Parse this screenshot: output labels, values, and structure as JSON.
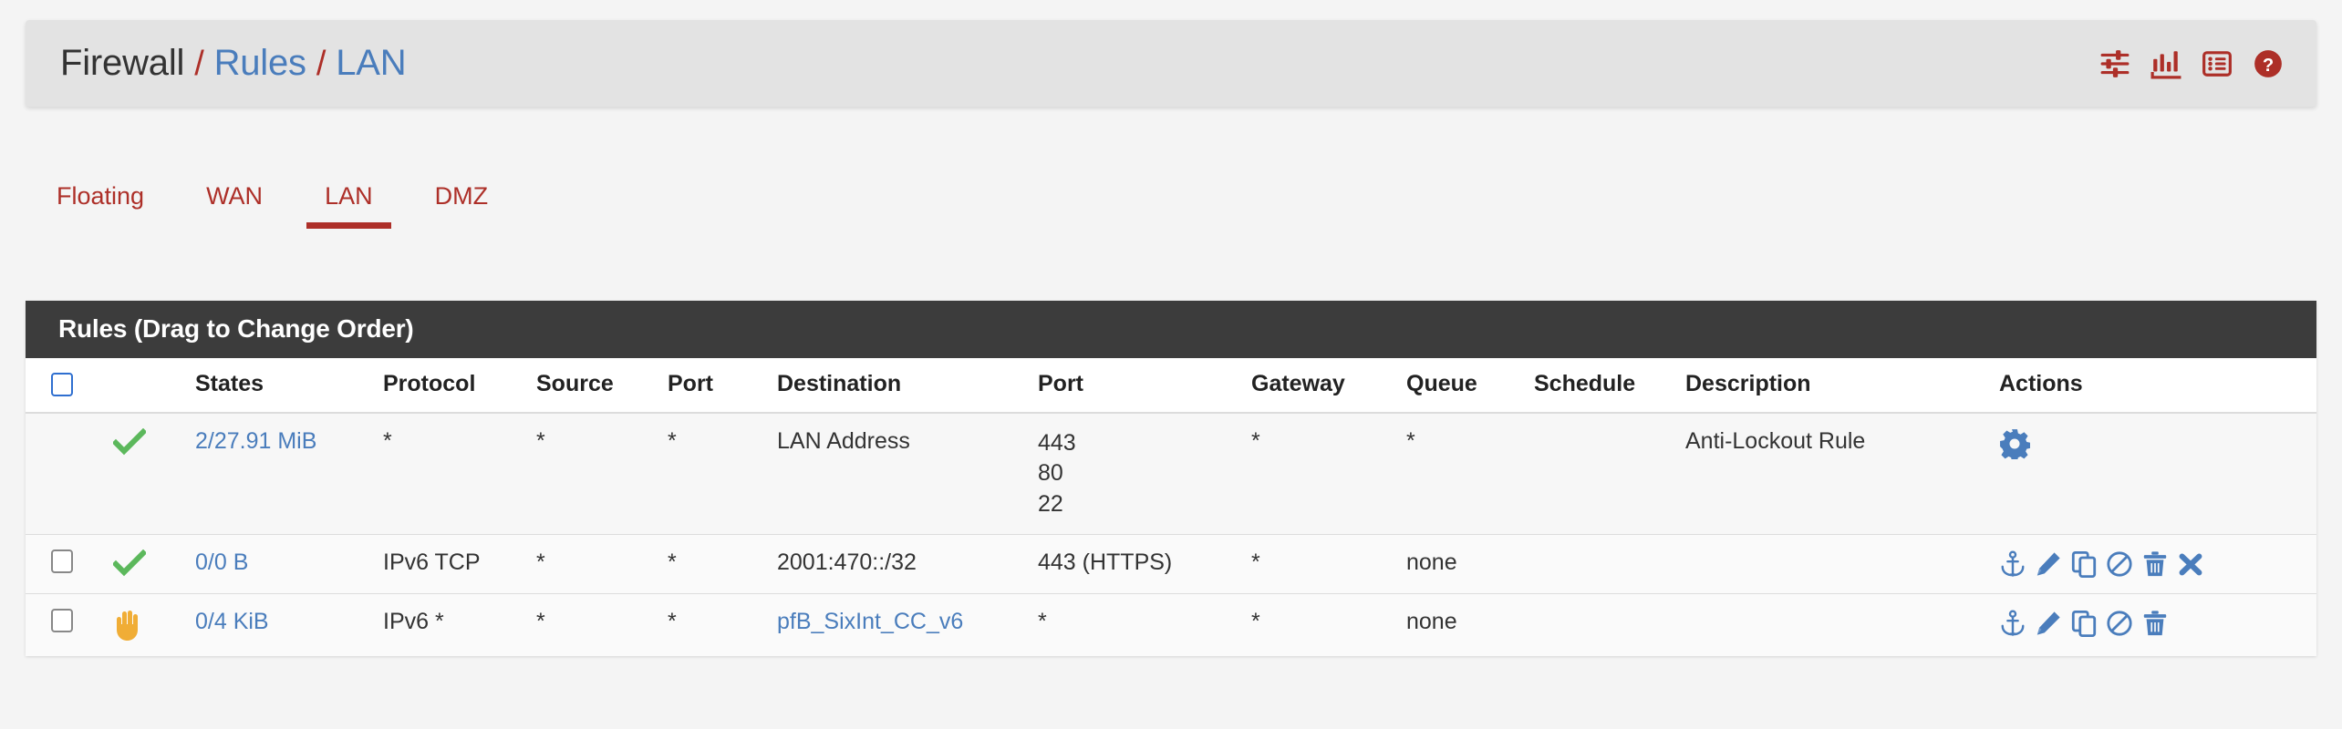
{
  "header": {
    "breadcrumb": {
      "root": "Firewall",
      "sep": "/",
      "items": [
        "Rules",
        "LAN"
      ]
    },
    "icons": [
      {
        "name": "sliders-icon",
        "label": "sliders-icon"
      },
      {
        "name": "bar-chart-icon",
        "label": "bar-chart-icon"
      },
      {
        "name": "list-icon",
        "label": "list-icon"
      },
      {
        "name": "help-circle-icon",
        "label": "help-circle-icon"
      }
    ],
    "accent_color": "#ad2f28",
    "link_color": "#4a7dbc"
  },
  "tabs": [
    {
      "label": "Floating",
      "active": false
    },
    {
      "label": "WAN",
      "active": false
    },
    {
      "label": "LAN",
      "active": true
    },
    {
      "label": "DMZ",
      "active": false
    }
  ],
  "panel": {
    "title": "Rules (Drag to Change Order)"
  },
  "table": {
    "columns": [
      "",
      "",
      "States",
      "Protocol",
      "Source",
      "Port",
      "Destination",
      "Port",
      "Gateway",
      "Queue",
      "Schedule",
      "Description",
      "Actions"
    ],
    "select_all_checkbox": "select-all-checkbox",
    "rows": [
      {
        "selectable": false,
        "status": "pass",
        "states": "2/27.91 MiB",
        "protocol": "*",
        "source": "*",
        "source_port": "*",
        "destination": "LAN Address",
        "destination_ports": [
          "443",
          "80",
          "22"
        ],
        "gateway": "*",
        "queue": "*",
        "schedule": "",
        "description": "Anti-Lockout Rule",
        "actions": [
          "gear-icon"
        ]
      },
      {
        "selectable": true,
        "status": "pass",
        "states": "0/0 B",
        "protocol": "IPv6 TCP",
        "source": "*",
        "source_port": "*",
        "destination": "2001:470::/32",
        "destination_ports": [
          "443 (HTTPS)"
        ],
        "gateway": "*",
        "queue": "none",
        "schedule": "",
        "description": "",
        "actions": [
          "anchor-icon",
          "pencil-icon",
          "copy-icon",
          "ban-icon",
          "trash-icon",
          "close-icon"
        ]
      },
      {
        "selectable": true,
        "status": "reject",
        "states": "0/4 KiB",
        "protocol": "IPv6 *",
        "source": "*",
        "source_port": "*",
        "destination": "pfB_SixInt_CC_v6",
        "destination_is_link": true,
        "destination_ports": [
          "*"
        ],
        "gateway": "*",
        "queue": "none",
        "schedule": "",
        "description": "",
        "actions": [
          "anchor-icon",
          "pencil-icon",
          "copy-icon",
          "ban-icon",
          "trash-icon"
        ]
      }
    ]
  },
  "colors": {
    "pass_green": "#5cb85c",
    "reject_yellow": "#f0ad36",
    "action_blue": "#4a7dbc",
    "panel_dark": "#3c3c3c"
  }
}
